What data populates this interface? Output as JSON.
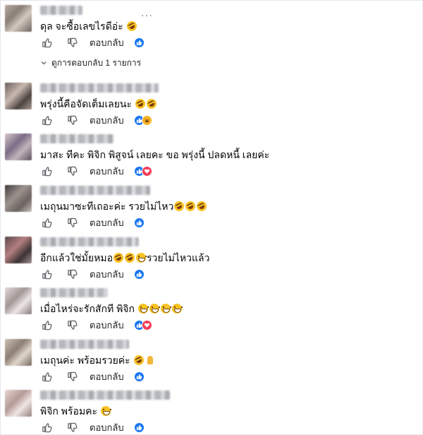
{
  "labels": {
    "reply": "ตอบกลับ",
    "more": "···"
  },
  "view_replies": "ดูการตอบกลับ 1 รายการ",
  "colors": {
    "like": "#1877f2",
    "love": "#f33e58",
    "haha": "#f7b125",
    "muted": "#65676b"
  },
  "comments": [
    {
      "text": "ดุล จะซื้อเลขไรดีอ่ะ",
      "emojis": [
        "rofl"
      ],
      "reactions": [
        "like"
      ]
    },
    {
      "text": "พรุ่งนี้คือจัดเต็มเลยนะ",
      "emojis": [
        "rofl",
        "rofl"
      ],
      "reactions": [
        "like",
        "haha"
      ]
    },
    {
      "text": "มาสะ ทีคะ พิจิก พิสูจน์ เลยคะ ขอ พรุ่งนี้ ปลดหนี้ เลยค่ะ",
      "emojis": [],
      "reactions": [
        "like",
        "love"
      ]
    },
    {
      "text": "เมถุนมาซะทีเถอะค่ะ รวยไม่ไหว",
      "emojis": [
        "rofl",
        "rofl",
        "rofl"
      ],
      "reactions": [
        "like"
      ]
    },
    {
      "text": "อีกแล้วใช่มั้ยหมอ",
      "emojis": [
        "rofl",
        "rofl",
        "grin"
      ],
      "text_after": "รวยไม่ไหวแล้ว",
      "reactions": [
        "like"
      ]
    },
    {
      "text": "เมื่อไหร่จะรักสักที พิจิก",
      "emojis": [
        "grin",
        "grin",
        "grin",
        "grin"
      ],
      "reactions": [
        "like",
        "love"
      ]
    },
    {
      "text": "เมถุนค่ะ พร้อมรวยค่ะ",
      "emojis": [
        "rofl",
        "pray"
      ],
      "reactions": [
        "like"
      ]
    },
    {
      "text": "พิจิก พร้อมคะ",
      "emojis": [
        "grin"
      ],
      "reactions": [
        "like"
      ]
    }
  ]
}
